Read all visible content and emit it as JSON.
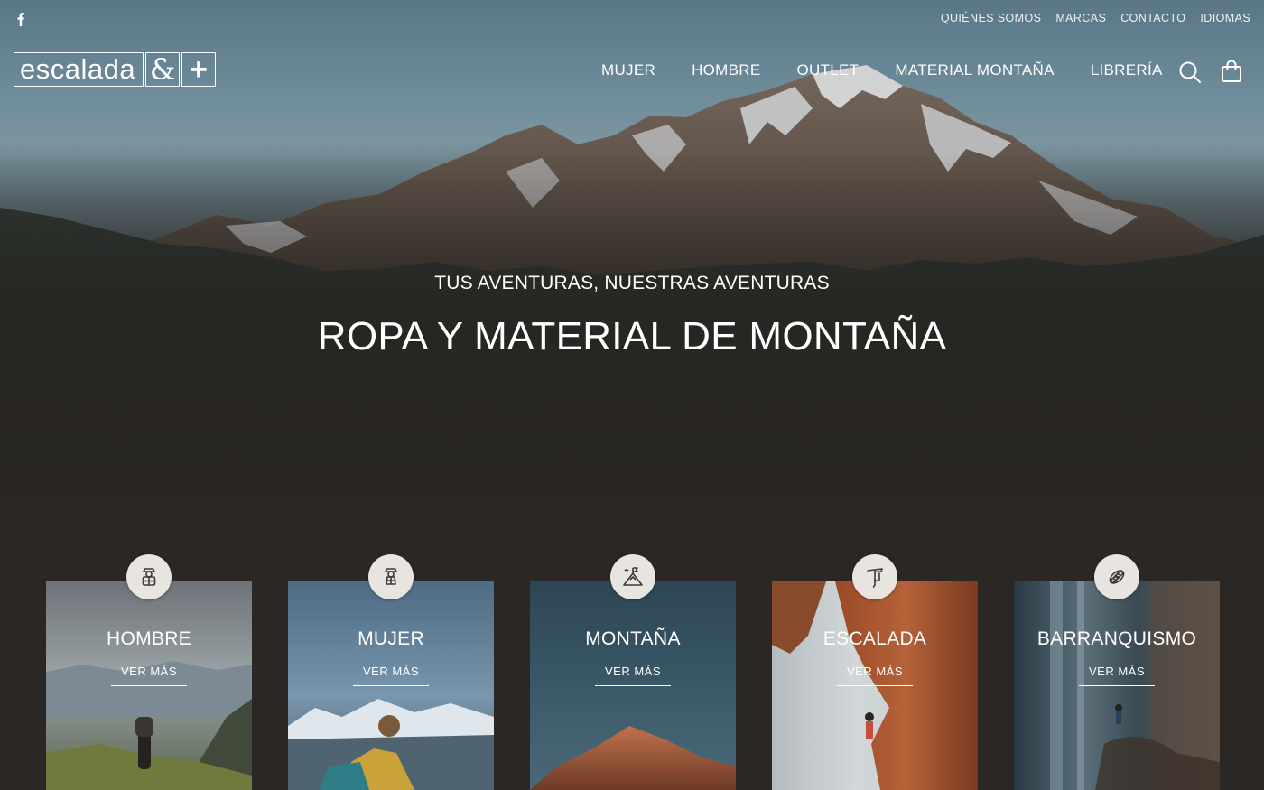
{
  "topbar": {
    "links": [
      "QUIÉNES SOMOS",
      "MARCAS",
      "CONTACTO",
      "IDIOMAS"
    ]
  },
  "logo": {
    "word": "escalada",
    "amp": "&",
    "plus": "+"
  },
  "nav": {
    "items": [
      "MUJER",
      "HOMBRE",
      "OUTLET",
      "MATERIAL MONTAÑA",
      "LIBRERÍA"
    ]
  },
  "hero": {
    "subtitle": "TUS AVENTURAS, NUESTRAS AVENTURAS",
    "title": "ROPA Y MATERIAL DE MONTAÑA"
  },
  "categories": [
    {
      "title": "HOMBRE",
      "link": "VER MÁS",
      "icon": "hiker-man-icon"
    },
    {
      "title": "MUJER",
      "link": "VER MÁS",
      "icon": "hiker-woman-icon"
    },
    {
      "title": "MONTAÑA",
      "link": "VER MÁS",
      "icon": "mountain-flag-icon"
    },
    {
      "title": "ESCALADA",
      "link": "VER MÁS",
      "icon": "ice-axe-icon"
    },
    {
      "title": "BARRANQUISMO",
      "link": "VER MÁS",
      "icon": "rope-icon"
    }
  ],
  "colors": {
    "background": "#2a2724",
    "badge": "#e8e5e1",
    "text": "#ffffff"
  }
}
